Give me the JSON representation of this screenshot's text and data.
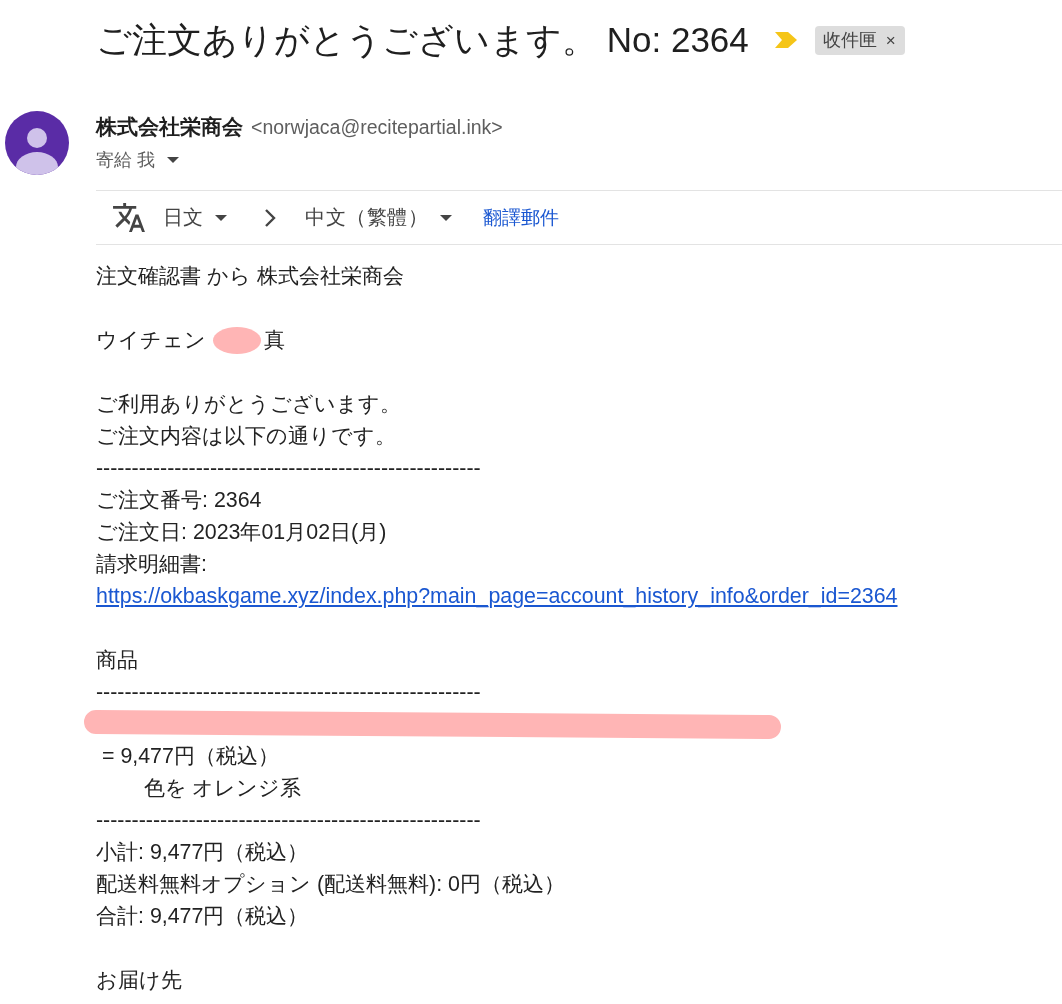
{
  "header": {
    "subject": "ご注文ありがとうございます。 No: 2364",
    "important": true,
    "labels": [
      {
        "text": "收件匣",
        "remove": "×"
      }
    ]
  },
  "sender": {
    "name": "株式会社栄商会",
    "email": "<norwjaca@recitepartial.ink>",
    "recipient": "寄給 我"
  },
  "translate_bar": {
    "source_language": "日文",
    "target_language": "中文（繁體）",
    "action": "翻譯郵件"
  },
  "body": {
    "paragraphs": [
      {
        "lines": [
          {
            "kind": "text",
            "text": "注文確認書 から 株式会社栄商会"
          }
        ]
      },
      {
        "lines": [
          {
            "kind": "redacted_name",
            "before": "ウイチェン",
            "after": "真"
          }
        ]
      },
      {
        "lines": [
          {
            "kind": "text",
            "text": "ご利用ありがとうございます。"
          },
          {
            "kind": "text",
            "text": "ご注文内容は以下の通りです。"
          },
          {
            "kind": "rule",
            "text": "------------------------------------------------------"
          },
          {
            "kind": "text",
            "text": "ご注文番号: 2364"
          },
          {
            "kind": "text",
            "text": "ご注文日: 2023年01月02日(月)"
          },
          {
            "kind": "text",
            "text": "請求明細書:"
          },
          {
            "kind": "link",
            "text": "https://okbaskgame.xyz/index.php?main_page=account_history_info&order_id=2364"
          }
        ]
      },
      {
        "lines": [
          {
            "kind": "text",
            "text": "商品"
          },
          {
            "kind": "rule",
            "text": "------------------------------------------------------"
          },
          {
            "kind": "redacted"
          },
          {
            "kind": "text",
            "text": " = 9,477円（税込）"
          },
          {
            "kind": "text",
            "text": "        色を オレンジ系"
          },
          {
            "kind": "rule",
            "text": "------------------------------------------------------"
          },
          {
            "kind": "text",
            "text": "小計: 9,477円（税込）"
          },
          {
            "kind": "text",
            "text": "配送料無料オプション (配送料無料): 0円（税込）"
          },
          {
            "kind": "text",
            "text": "合計: 9,477円（税込）"
          }
        ]
      },
      {
        "lines": [
          {
            "kind": "text",
            "text": "お届け先"
          }
        ]
      }
    ]
  }
}
